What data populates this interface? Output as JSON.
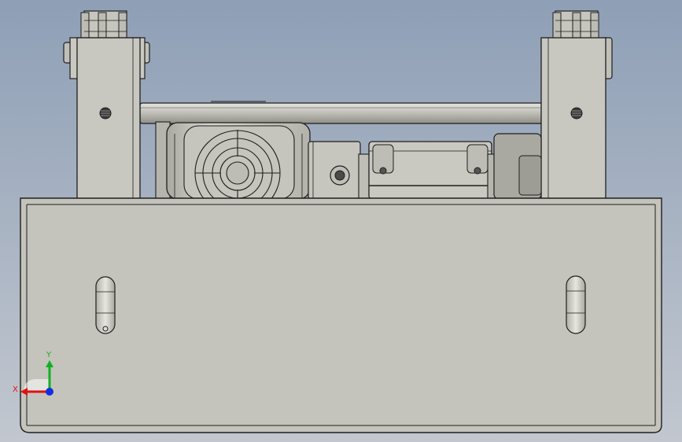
{
  "viewport": {
    "background_top": "#8e9fb6",
    "background_bottom": "#c2c7cf"
  },
  "colors": {
    "metal_light": "#c9c9c1",
    "metal_mid": "#b9b9b1",
    "metal_dark": "#9a9a92",
    "edge": "#1e1e1e",
    "axis_x": "#e01010",
    "axis_y": "#10b020",
    "axis_z": "#1030e0"
  },
  "triad": {
    "x_label": "X",
    "y_label": "Y"
  },
  "icons": [
    "coordinate-triad-icon",
    "fan-grille-icon"
  ]
}
